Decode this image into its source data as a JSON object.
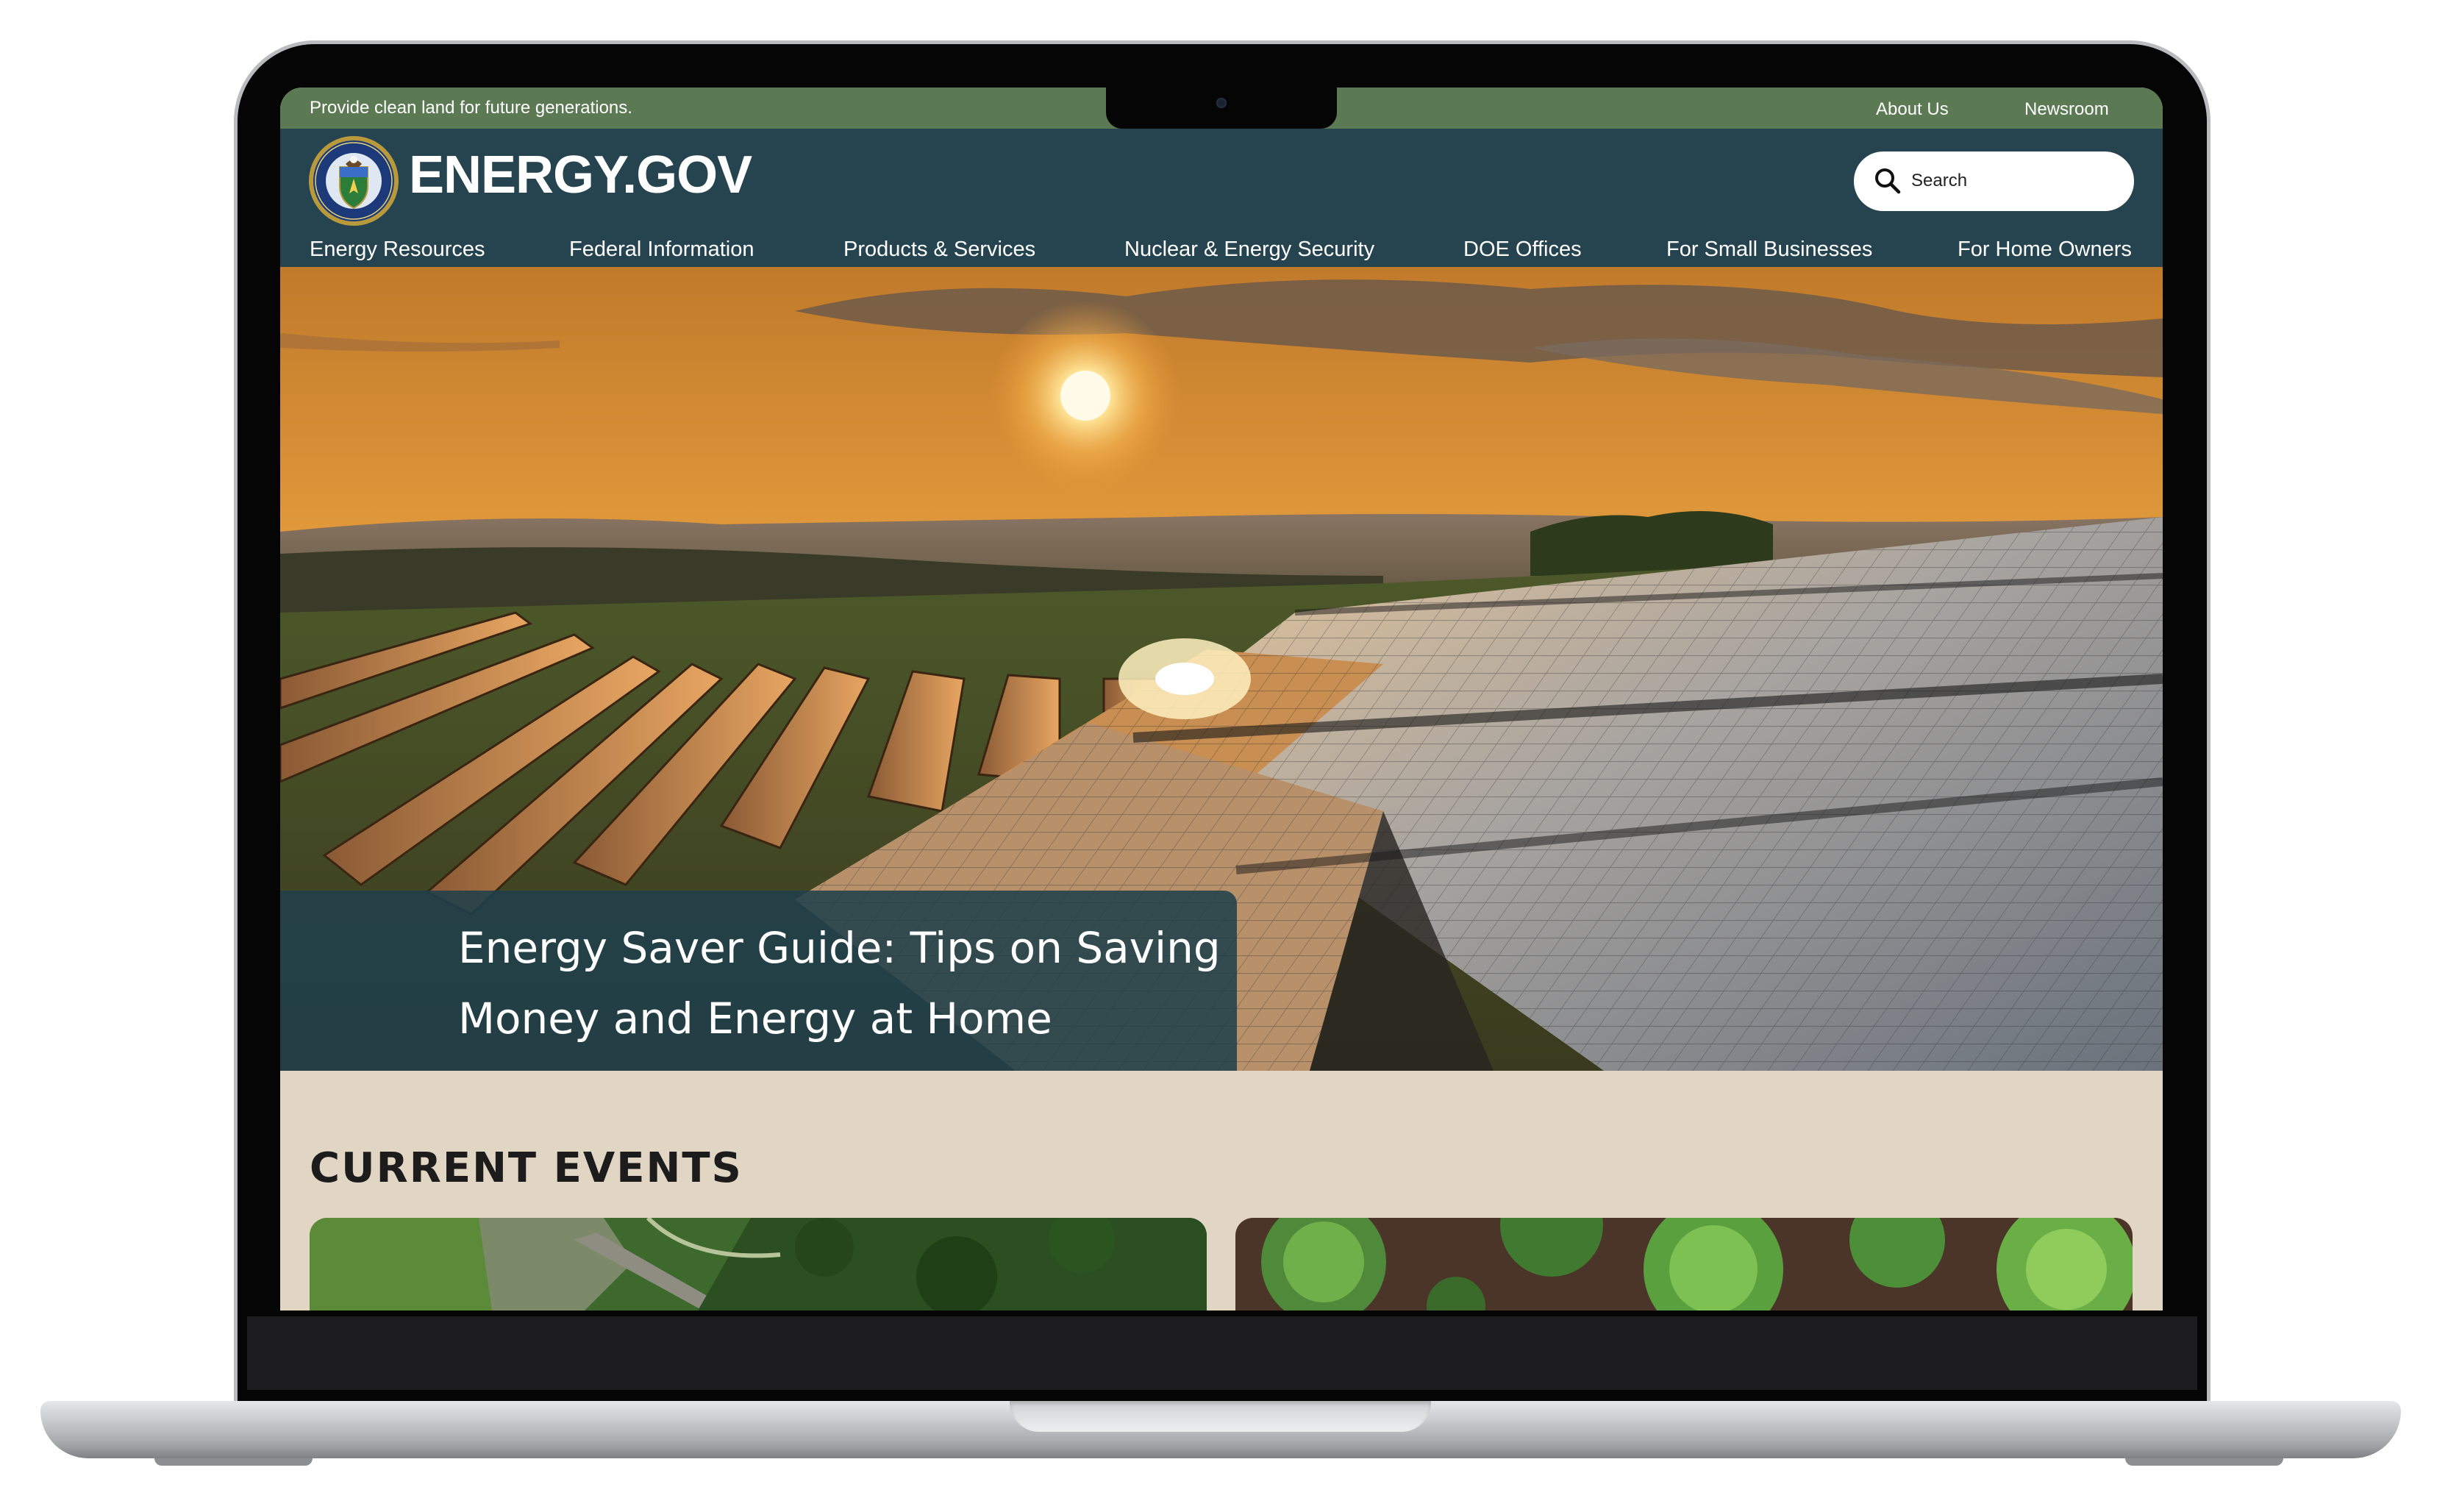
{
  "utility_bar": {
    "tagline": "Provide clean land for future generations.",
    "links": [
      {
        "label": "About Us"
      },
      {
        "label": "Newsroom"
      }
    ]
  },
  "header": {
    "logo_text": "ENERGY.GOV",
    "search_placeholder": "Search"
  },
  "nav": {
    "items": [
      {
        "label": "Energy Resources"
      },
      {
        "label": "Federal Information"
      },
      {
        "label": "Products & Services"
      },
      {
        "label": "Nuclear & Energy Security"
      },
      {
        "label": "DOE Offices"
      },
      {
        "label": "For Small Businesses"
      },
      {
        "label": "For Home Owners"
      }
    ]
  },
  "hero": {
    "title": "Energy Saver Guide: Tips on Saving Money and Energy at Home"
  },
  "events": {
    "heading": "CURRENT EVENTS"
  },
  "colors": {
    "utility_bar": "#5b7a54",
    "header": "#254450",
    "caption_bg": "#20404b",
    "events_bg": "#e1d5c4"
  }
}
